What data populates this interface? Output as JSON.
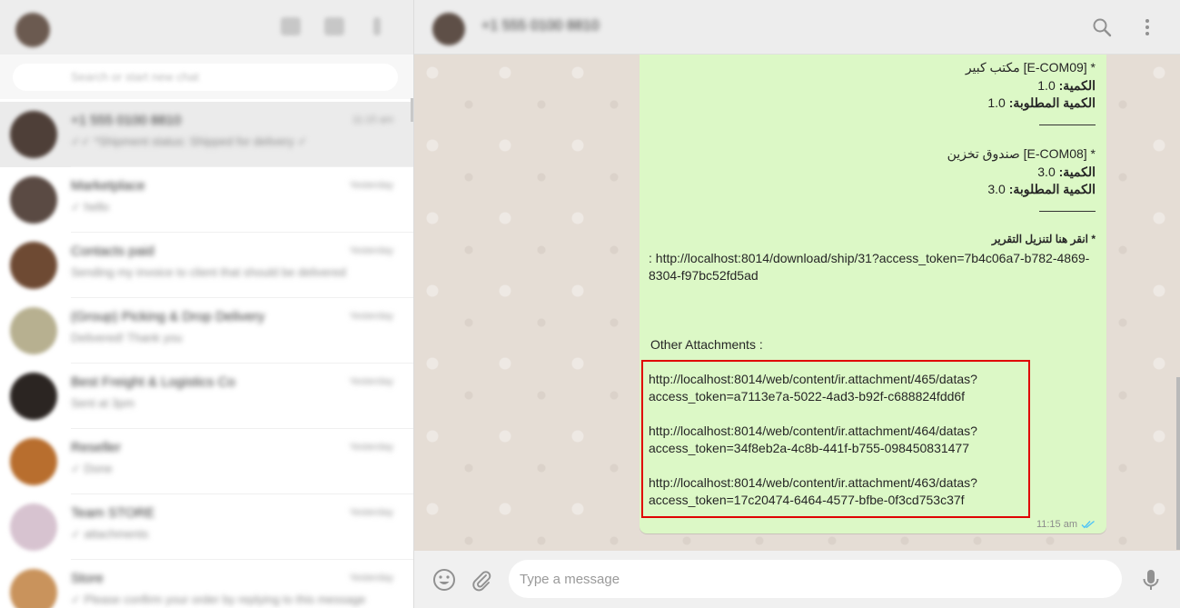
{
  "sidebar": {
    "search_placeholder": "Search or start new chat",
    "chats": [
      {
        "name": "+1 555 0100 8810",
        "time": "11:15 am",
        "preview": "✓✓ *Shipment status: Shipped for delivery ✓",
        "avatar_color": "#4e3f38",
        "active": true
      },
      {
        "name": "Marketplace",
        "time": "Yesterday",
        "preview": "✓ hello",
        "avatar_color": "#5a4a43",
        "active": false
      },
      {
        "name": "Contacts paid",
        "time": "Yesterday",
        "preview": "Sending my invoice to client that should be delivered",
        "avatar_color": "#6e4a33",
        "active": false
      },
      {
        "name": "(Group) Picking & Drop Delivery",
        "time": "Yesterday",
        "preview": "Delivered! Thank you",
        "avatar_color": "#b7b090",
        "active": false
      },
      {
        "name": "Best Freight & Logistics Co",
        "time": "Yesterday",
        "preview": "Sent at 3pm",
        "avatar_color": "#2b2522",
        "active": false
      },
      {
        "name": "Reseller",
        "time": "Yesterday",
        "preview": "✓ Done",
        "avatar_color": "#b86e2e",
        "active": false
      },
      {
        "name": "Team STORE",
        "time": "Yesterday",
        "preview": "✓ attachments",
        "avatar_color": "#d7c3d0",
        "active": false
      },
      {
        "name": "Store",
        "time": "Yesterday",
        "preview": "✓ Please confirm your order by replying to this message",
        "avatar_color": "#c9935c",
        "active": false
      }
    ]
  },
  "conversation": {
    "contact_name": "+1 555 0100 8810",
    "message": {
      "item1_header": "* [E-COM09] مكتب كبير",
      "item1_qty_label": "الكمية:",
      "item1_qty": "1.0",
      "item1_req_label": "الكمية المطلوبة:",
      "item1_req": "1.0",
      "item2_header": "* [E-COM08] صندوق تخزين",
      "item2_qty_label": "الكمية:",
      "item2_qty": "3.0",
      "item2_req_label": "الكمية المطلوبة:",
      "item2_req": "3.0",
      "download_label": "* انقر هنا لتنزيل التقرير",
      "download_link_line1": ": http://localhost:8014/download/ship/31?access_token=7b4c06a7-b782-4869-",
      "download_link_line2": "8304-f97bc52fd5ad",
      "other_attachments_label": "Other Attachments :",
      "attachments": [
        {
          "line1": "http://localhost:8014/web/content/ir.attachment/465/datas?",
          "line2": "access_token=a7113e7a-5022-4ad3-b92f-c688824fdd6f"
        },
        {
          "line1": "http://localhost:8014/web/content/ir.attachment/464/datas?",
          "line2": "access_token=34f8eb2a-4c8b-441f-b755-098450831477"
        },
        {
          "line1": "http://localhost:8014/web/content/ir.attachment/463/datas?",
          "line2": "access_token=17c20474-6464-4577-bfbe-0f3cd753c37f"
        }
      ],
      "time": "11:15 am",
      "status_icon": "double-check-icon"
    }
  },
  "composer": {
    "placeholder": "Type a message"
  },
  "colors": {
    "bubble": "#dcf8c6",
    "conversation_bg": "#e5ddd5",
    "highlight_border": "#e00000",
    "read_ticks": "#4fc3f7"
  }
}
